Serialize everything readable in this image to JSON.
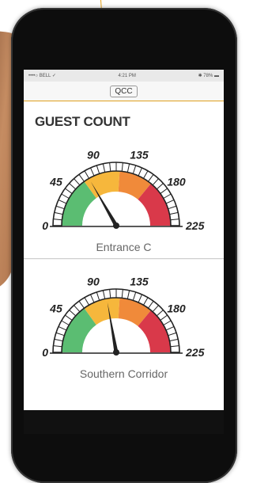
{
  "status_bar": {
    "left": "••••○ BELL ✓",
    "center": "4:21 PM",
    "right": "✱ 78% ▬"
  },
  "nav": {
    "title": "QCC"
  },
  "section_title": "GUEST COUNT",
  "gauge_ticks": [
    "0",
    "45",
    "90",
    "135",
    "180",
    "225"
  ],
  "gauges": [
    {
      "label": "Entrance C",
      "value": 75,
      "max": 225
    },
    {
      "label": "Southern Corridor",
      "value": 100,
      "max": 225
    }
  ],
  "colors": {
    "green": "#5bbd72",
    "yellow": "#f6b73c",
    "orange": "#f08a3a",
    "red": "#d9394a",
    "accent": "#e6a21a"
  }
}
